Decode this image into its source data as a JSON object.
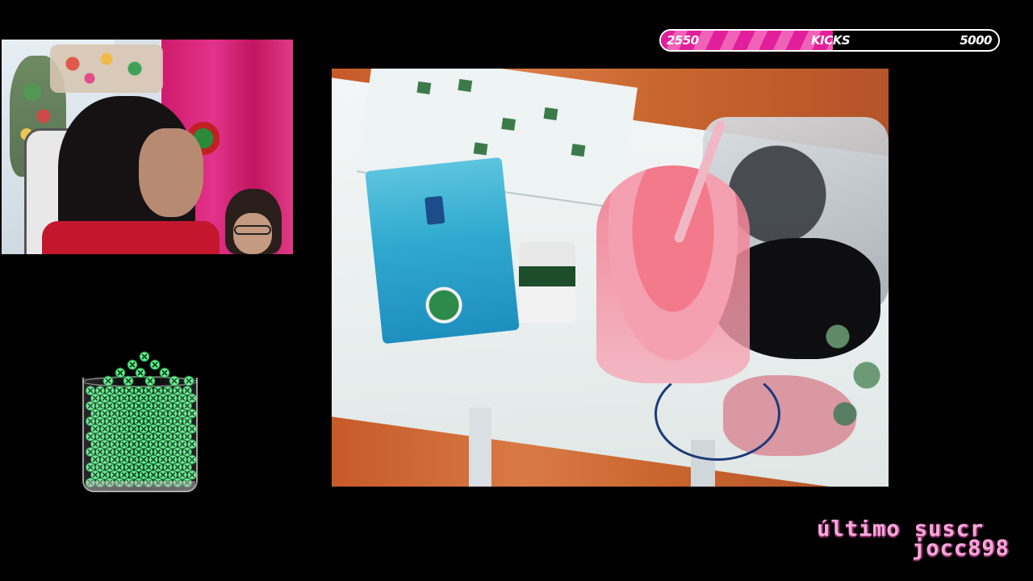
{
  "kicks_goal": {
    "current_label": "2550",
    "label": "KICKS",
    "goal_label": "5000",
    "progress_fraction": 0.51,
    "fill_color": "#e21f9a",
    "stripe_color": "#f062b8"
  },
  "latest_subscriber": {
    "title": "último suscr",
    "username": "jocc898"
  },
  "jar": {
    "gem_color": "#5cf08a",
    "icon": "gem-jar-icon"
  },
  "webcam": {
    "icon": "webcam-feed"
  },
  "main_feed": {
    "icon": "camera-feed"
  }
}
